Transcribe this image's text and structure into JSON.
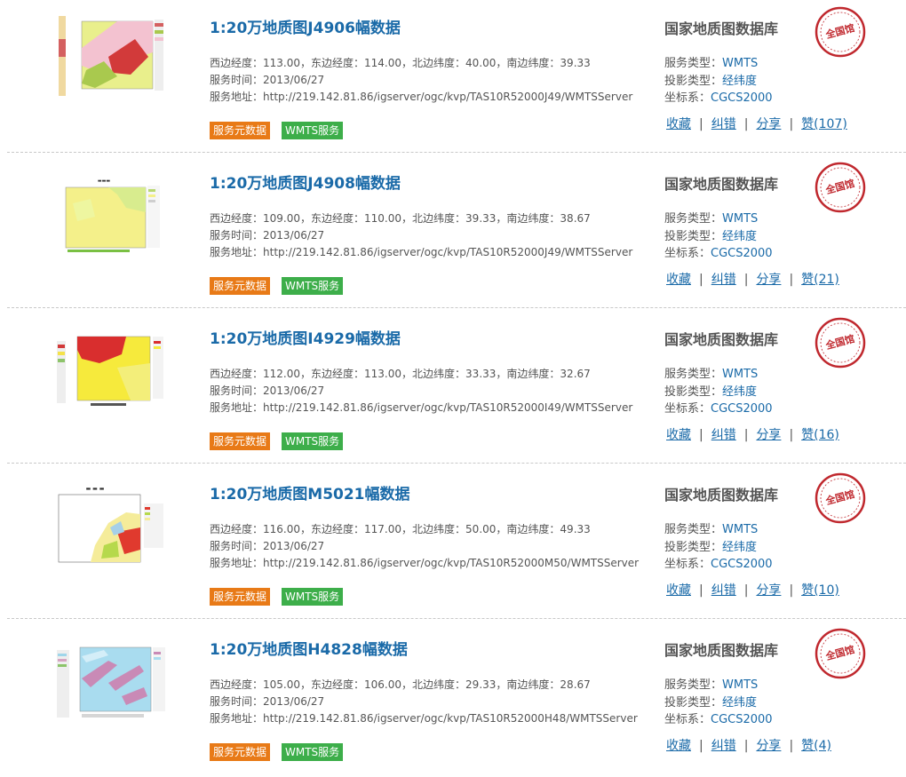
{
  "labels": {
    "west": "西边经度：",
    "east": "，东边经度：",
    "north": "，北边纬度：",
    "south": "，南边纬度：",
    "time": "服务时间：",
    "addr": "服务地址：",
    "service_type": "服务类型：",
    "projection": "投影类型：",
    "crs": "坐标系："
  },
  "tags": {
    "meta": "服务元数据",
    "wmts": "WMTS服务"
  },
  "actions": {
    "collect": "收藏",
    "correct": "纠错",
    "share": "分享",
    "like_prefix": "赞"
  },
  "separator": "|",
  "seal_text": "全国馆",
  "items": [
    {
      "title": "1:20万地质图J4906幅数据",
      "west": "113.00",
      "east": "114.00",
      "north": "40.00",
      "south": "39.33",
      "time": "2013/06/27",
      "addr": "http://219.142.81.86/igserver/ogc/kvp/TAS10R52000J49/WMTSServer",
      "db": "国家地质图数据库",
      "service_type": "WMTS",
      "projection": "经纬度",
      "crs": "CGCS2000",
      "likes": "(107)"
    },
    {
      "title": "1:20万地质图J4908幅数据",
      "west": "109.00",
      "east": "110.00",
      "north": "39.33",
      "south": "38.67",
      "time": "2013/06/27",
      "addr": "http://219.142.81.86/igserver/ogc/kvp/TAS10R52000J49/WMTSServer",
      "db": "国家地质图数据库",
      "service_type": "WMTS",
      "projection": "经纬度",
      "crs": "CGCS2000",
      "likes": "(21)"
    },
    {
      "title": "1:20万地质图I4929幅数据",
      "west": "112.00",
      "east": "113.00",
      "north": "33.33",
      "south": "32.67",
      "time": "2013/06/27",
      "addr": "http://219.142.81.86/igserver/ogc/kvp/TAS10R52000I49/WMTSServer",
      "db": "国家地质图数据库",
      "service_type": "WMTS",
      "projection": "经纬度",
      "crs": "CGCS2000",
      "likes": "(16)"
    },
    {
      "title": "1:20万地质图M5021幅数据",
      "west": "116.00",
      "east": "117.00",
      "north": "50.00",
      "south": "49.33",
      "time": "2013/06/27",
      "addr": "http://219.142.81.86/igserver/ogc/kvp/TAS10R52000M50/WMTSServer",
      "db": "国家地质图数据库",
      "service_type": "WMTS",
      "projection": "经纬度",
      "crs": "CGCS2000",
      "likes": "(10)"
    },
    {
      "title": "1:20万地质图H4828幅数据",
      "west": "105.00",
      "east": "106.00",
      "north": "29.33",
      "south": "28.67",
      "time": "2013/06/27",
      "addr": "http://219.142.81.86/igserver/ogc/kvp/TAS10R52000H48/WMTSServer",
      "db": "国家地质图数据库",
      "service_type": "WMTS",
      "projection": "经纬度",
      "crs": "CGCS2000",
      "likes": "(4)"
    }
  ],
  "colors": {
    "link": "#1a6aa8",
    "tag_meta": "#e87a17",
    "tag_wmts": "#3dae4a",
    "seal": "#c0282e"
  }
}
